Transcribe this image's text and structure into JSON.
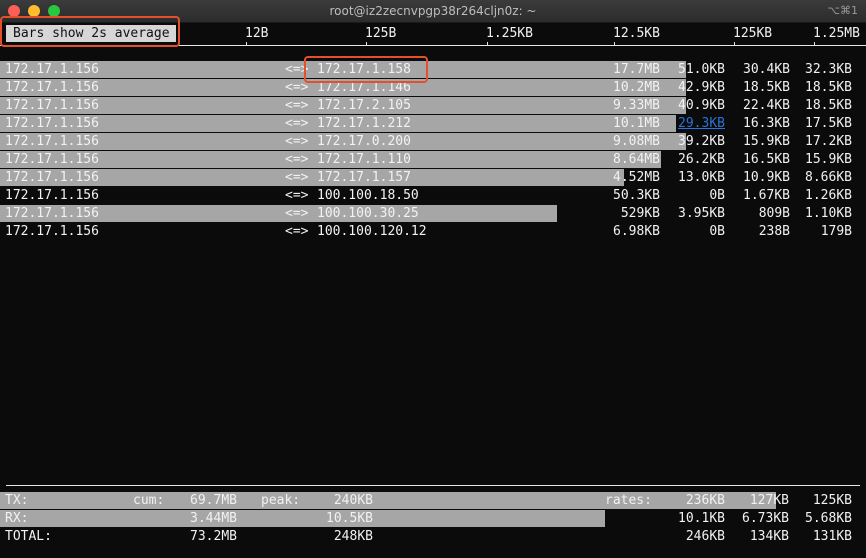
{
  "window": {
    "title": "root@iz2zecnvpgp38r264cljn0z: ~",
    "shortcut": "⌥⌘1"
  },
  "scale": {
    "label": "Bars show 2s average",
    "ticks": [
      "12B",
      "125B",
      "1.25KB",
      "12.5KB",
      "125KB",
      "1.25MB"
    ]
  },
  "flows": [
    {
      "src": "172.17.1.156",
      "dir": "<=>",
      "dst": "172.17.1.158",
      "r2": "17.7MB",
      "r10": "51.0KB",
      "r40": "30.4KB",
      "total": "32.3KB"
    },
    {
      "src": "172.17.1.156",
      "dir": "<=>",
      "dst": "172.17.1.146",
      "r2": "10.2MB",
      "r10": "42.9KB",
      "r40": "18.5KB",
      "total": "18.5KB"
    },
    {
      "src": "172.17.1.156",
      "dir": "<=>",
      "dst": "172.17.2.105",
      "r2": "9.33MB",
      "r10": "40.9KB",
      "r40": "22.4KB",
      "total": "18.5KB"
    },
    {
      "src": "172.17.1.156",
      "dir": "<=>",
      "dst": "172.17.1.212",
      "r2": "10.1MB",
      "r10": "29.3KB",
      "r40": "16.3KB",
      "total": "17.5KB"
    },
    {
      "src": "172.17.1.156",
      "dir": "<=>",
      "dst": "172.17.0.200",
      "r2": "9.08MB",
      "r10": "39.2KB",
      "r40": "15.9KB",
      "total": "17.2KB"
    },
    {
      "src": "172.17.1.156",
      "dir": "<=>",
      "dst": "172.17.1.110",
      "r2": "8.64MB",
      "r10": "26.2KB",
      "r40": "16.5KB",
      "total": "15.9KB"
    },
    {
      "src": "172.17.1.156",
      "dir": "<=>",
      "dst": "172.17.1.157",
      "r2": "4.52MB",
      "r10": "13.0KB",
      "r40": "10.9KB",
      "total": "8.66KB"
    },
    {
      "src": "172.17.1.156",
      "dir": "<=>",
      "dst": "100.100.18.50",
      "r2": "50.3KB",
      "r10": "0B",
      "r40": "1.67KB",
      "total": "1.26KB"
    },
    {
      "src": "172.17.1.156",
      "dir": "<=>",
      "dst": "100.100.30.25",
      "r2": "529KB",
      "r10": "3.95KB",
      "r40": "809B",
      "total": "1.10KB"
    },
    {
      "src": "172.17.1.156",
      "dir": "<=>",
      "dst": "100.100.120.12",
      "r2": "6.98KB",
      "r10": "0B",
      "r40": "238B",
      "total": "179B"
    }
  ],
  "totals": {
    "tx": {
      "label": "TX:",
      "cum_label": "cum:",
      "cum": "69.7MB",
      "peak_label": "peak:",
      "peak": "240KB",
      "rates_label": "rates:",
      "r2": "236KB",
      "r10": "127KB",
      "r40": "125KB"
    },
    "rx": {
      "label": "RX:",
      "cum": "3.44MB",
      "peak": "10.5KB",
      "r2": "10.1KB",
      "r10": "6.73KB",
      "r40": "5.68KB"
    },
    "total": {
      "label": "TOTAL:",
      "cum": "73.2MB",
      "peak": "248KB",
      "r2": "246KB",
      "r10": "134KB",
      "r40": "131KB"
    }
  },
  "colors": {
    "bar": "#a6a6a6",
    "highlight": "#e4502b",
    "link": "#2a73d8"
  }
}
